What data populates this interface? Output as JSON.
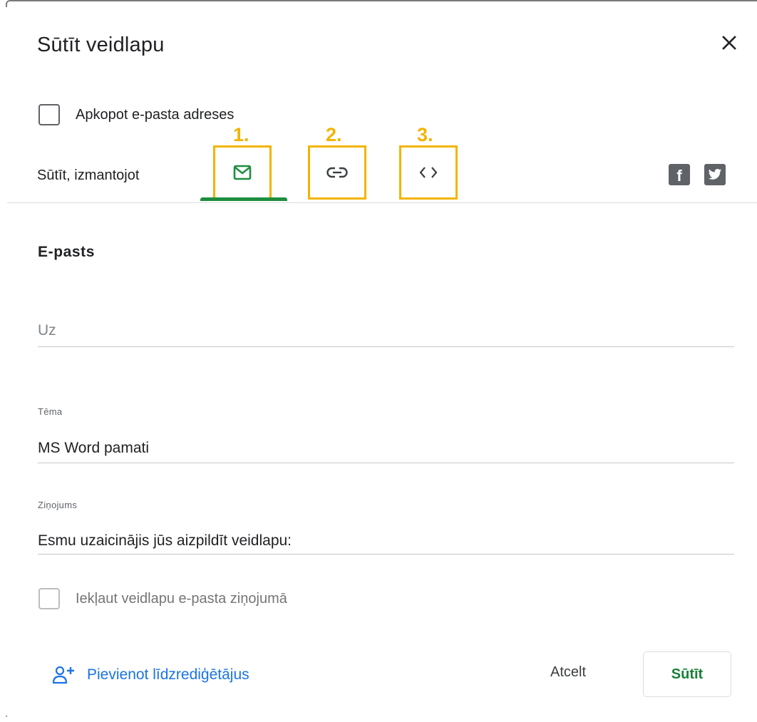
{
  "dialog": {
    "title": "Sūtīt veidlapu"
  },
  "collect_emails": {
    "label": "Apkopot e-pasta adreses",
    "checked": false
  },
  "send_via": {
    "label": "Sūtīt, izmantojot",
    "annotations": [
      "1.",
      "2.",
      "3."
    ],
    "tabs": [
      {
        "id": "email",
        "icon": "mail-icon",
        "active": true
      },
      {
        "id": "link",
        "icon": "link-icon",
        "active": false
      },
      {
        "id": "embed",
        "icon": "embed-code-icon",
        "active": false
      }
    ],
    "social": [
      {
        "icon": "facebook-icon",
        "glyph": "f"
      },
      {
        "icon": "twitter-icon",
        "glyph": "🐦"
      }
    ]
  },
  "email_section": {
    "title": "E-pasts",
    "to": {
      "placeholder": "Uz",
      "value": ""
    },
    "subject": {
      "label": "Tēma",
      "value": "MS Word pamati"
    },
    "message": {
      "label": "Ziņojums",
      "value": "Esmu uzaicinājis jūs aizpildīt veidlapu:"
    },
    "include_form": {
      "label": "Iekļaut veidlapu e-pasta ziņojumā",
      "checked": false,
      "disabled": true
    }
  },
  "footer": {
    "add_editors": "Pievienot līdzrediģētājus",
    "cancel": "Atcelt",
    "send": "Sūtīt"
  },
  "colors": {
    "accent_green": "#1e8e3e",
    "highlight_yellow": "#f2b400",
    "link_blue": "#1a73e8"
  }
}
